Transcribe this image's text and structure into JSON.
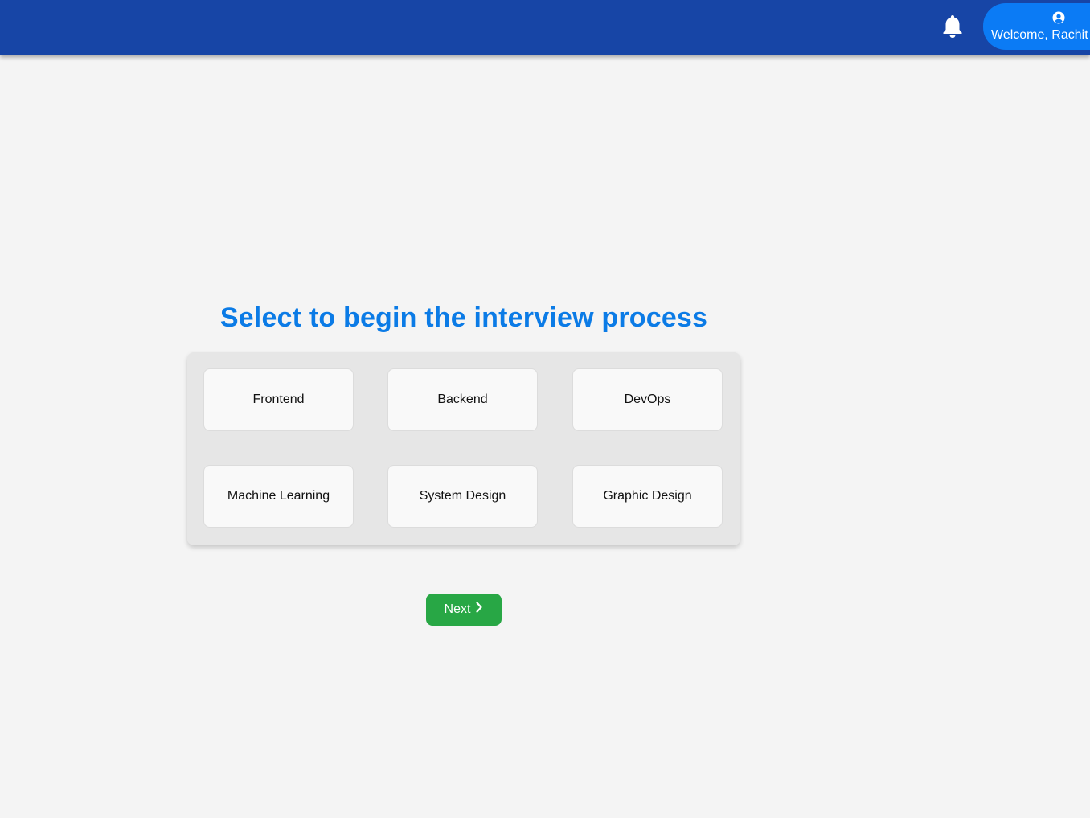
{
  "header": {
    "welcome_label": "Welcome, Rachit",
    "notification_icon": "bell-icon",
    "user_icon": "user-circle-icon",
    "bar_color": "#1745a6",
    "welcome_color": "#0b7bf5"
  },
  "main": {
    "title": "Select to begin the interview process",
    "title_color": "#0b7be6",
    "options": [
      {
        "label": "Frontend"
      },
      {
        "label": "Backend"
      },
      {
        "label": "DevOps"
      },
      {
        "label": "Machine Learning"
      },
      {
        "label": "System Design"
      },
      {
        "label": "Graphic Design"
      }
    ],
    "next_label": "Next",
    "next_icon": "chevron-right-icon",
    "next_color": "#28a745"
  }
}
